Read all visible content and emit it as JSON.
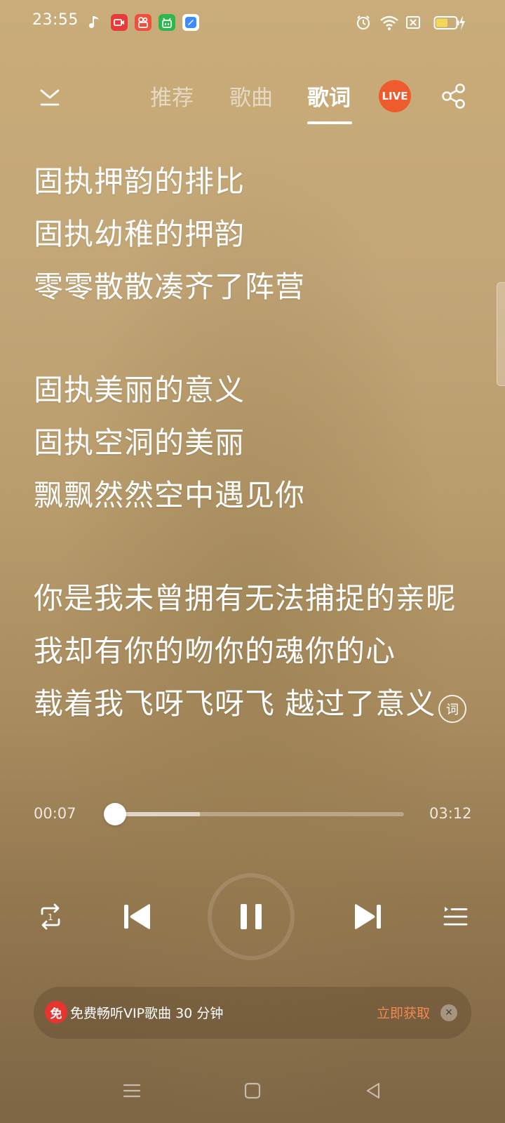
{
  "status_bar": {
    "time": "23:55",
    "apps": [
      "music-note-icon",
      "video-record-icon",
      "kuaishou-icon",
      "shop-icon",
      "wallet-icon"
    ],
    "indicators": [
      "alarm-icon",
      "wifi-icon",
      "sim-disabled-icon",
      "battery-charging-icon"
    ]
  },
  "header": {
    "tabs": [
      {
        "label": "推荐",
        "active": false
      },
      {
        "label": "歌曲",
        "active": false
      },
      {
        "label": "歌词",
        "active": true
      }
    ],
    "live_label": "LIVE"
  },
  "lyrics": {
    "lines": [
      "固执押韵的排比",
      "固执幼稚的押韵",
      "零零散散凑齐了阵营",
      "",
      "固执美丽的意义",
      "固执空洞的美丽",
      "飘飘然然空中遇见你",
      "",
      "你是我未曾拥有无法捕捉的亲昵",
      "我却有你的吻你的魂你的心",
      "载着我飞呀飞呀飞 越过了意义"
    ],
    "lyric_button_label": "词"
  },
  "player": {
    "current_time": "00:07",
    "total_time": "03:12",
    "progress": 0.037,
    "buffered": 0.32
  },
  "promo": {
    "badge": "免",
    "text": "免费畅听VIP歌曲 30 分钟",
    "action": "立即获取"
  },
  "colors": {
    "accent_live": "#ee5b2c",
    "promo_action": "#f08a52",
    "promo_badge": "#e8342f"
  }
}
